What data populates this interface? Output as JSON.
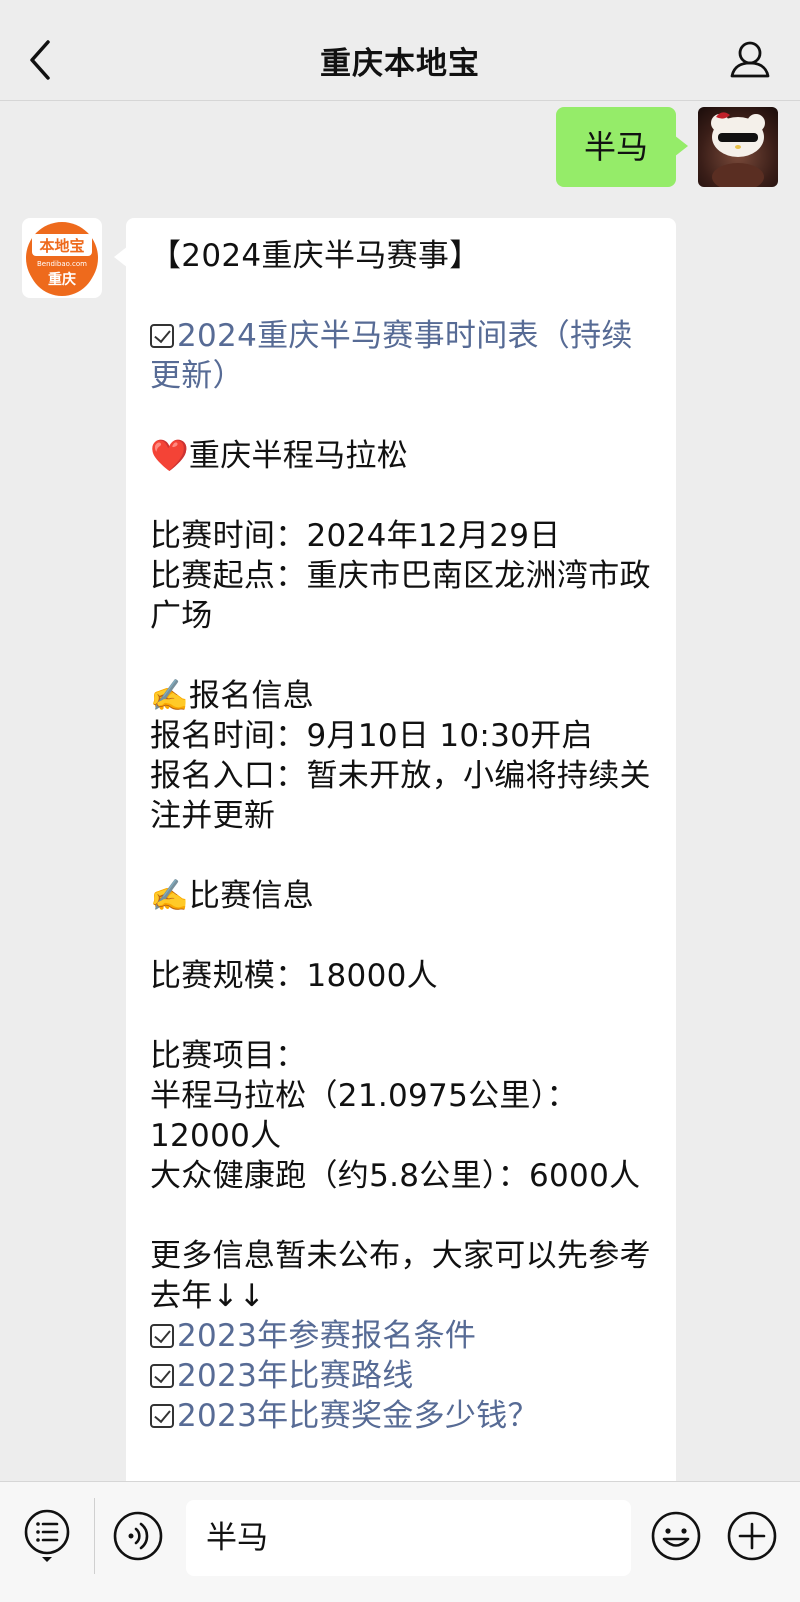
{
  "header": {
    "title": "重庆本地宝"
  },
  "chat": {
    "my_message": "半马",
    "bot_logo": {
      "brand": "本地宝",
      "domain": "Bendibao.com",
      "city": "重庆"
    },
    "bot_lines": [
      "【2024重庆半马赛事】",
      "",
      "2024重庆半马赛事时间表（持续更新）",
      "",
      "重庆半程马拉松",
      "",
      "比赛时间：2024年12月29日",
      "比赛起点：重庆市巴南区龙洲湾市政广场",
      "",
      "报名信息",
      "报名时间：9月10日 10:30开启",
      "报名入口：暂未开放，小编将持续关注并更新",
      "",
      "比赛信息",
      "",
      "比赛规模：18000人",
      "",
      "比赛项目：",
      "半程马拉松（21.0975公里）：12000人",
      "大众健康跑（约5.8公里）：6000人",
      "",
      "更多信息暂未公布，大家可以先参考去年↓↓",
      "2023年参赛报名条件",
      "2023年比赛路线",
      "2023年比赛奖金多少钱？"
    ],
    "emoji": {
      "heart": "❤️",
      "writing_hand": "✍️"
    },
    "link_color": "#576b95",
    "bubble_green": "#95ec69"
  },
  "bottombar": {
    "input_value": "半马"
  },
  "icons": [
    "back-icon",
    "profile-icon",
    "menu-list-icon",
    "voice-icon",
    "emoji-icon",
    "plus-icon"
  ]
}
